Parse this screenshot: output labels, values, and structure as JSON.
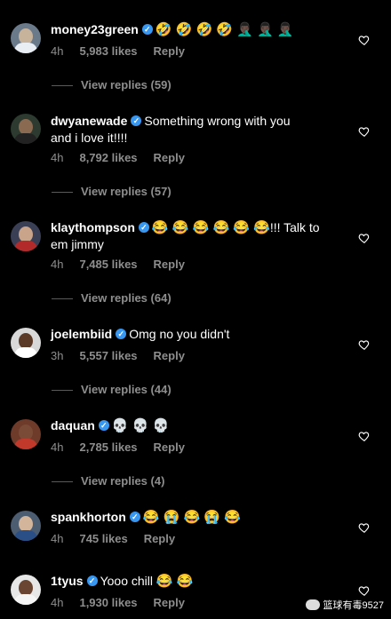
{
  "comments": [
    {
      "username": "money23green",
      "text": "",
      "emoji": "🤣 🤣 🤣 🤣 🤦🏿‍♂️ 🤦🏿‍♂️ 🤦🏿‍♂️",
      "time": "4h",
      "likes": "5,983 likes",
      "reply": "Reply",
      "replies": "View replies (59)"
    },
    {
      "username": "dwyanewade",
      "text": "Something wrong with you",
      "text2": "and i love it!!!!",
      "time": "4h",
      "likes": "8,792 likes",
      "reply": "Reply",
      "replies": "View replies (57)"
    },
    {
      "username": "klaythompson",
      "emoji": "😂 😂 😂 😂 😂 😂",
      "text": "!!! Talk to",
      "text2": "em jimmy",
      "time": "4h",
      "likes": "7,485 likes",
      "reply": "Reply",
      "replies": "View replies (64)"
    },
    {
      "username": "joelembiid",
      "text": "Omg no you didn't",
      "time": "3h",
      "likes": "5,557 likes",
      "reply": "Reply",
      "replies": "View replies (44)"
    },
    {
      "username": "daquan",
      "text": "",
      "emoji": "💀 💀 💀",
      "time": "4h",
      "likes": "2,785 likes",
      "reply": "Reply",
      "replies": "View replies (4)"
    },
    {
      "username": "spankhorton",
      "text": "",
      "emoji": "😂 😭 😂 😭 😂",
      "time": "4h",
      "likes": "745 likes",
      "reply": "Reply"
    },
    {
      "username": "1tyus",
      "text": "Yooo chill",
      "emoji": "😂 😂",
      "time": "4h",
      "likes": "1,930 likes",
      "reply": "Reply"
    }
  ],
  "watermark": "篮球有毒9527",
  "colors": {
    "verified": "#3897f0",
    "muted": "#8e8e8e",
    "background": "#000000"
  }
}
